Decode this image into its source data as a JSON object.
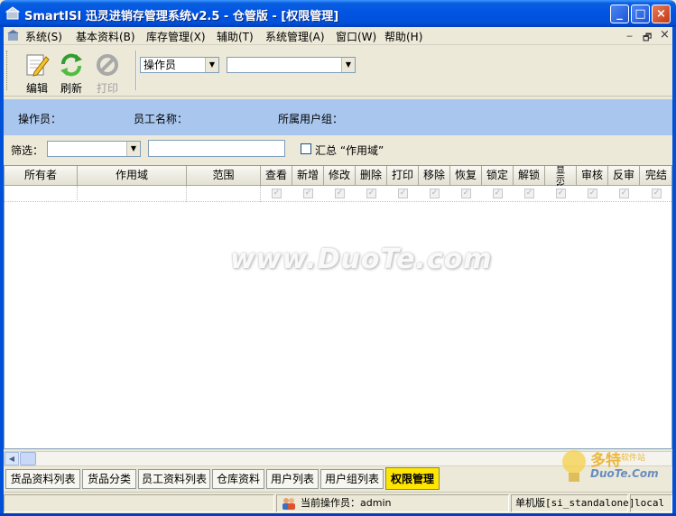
{
  "window": {
    "title": "SmartISI 迅灵进销存管理系统v2.5 - 仓管版 - [权限管理]",
    "minimize": "_",
    "maximize": "□",
    "close": "×"
  },
  "menu": {
    "items": [
      "系统(S)",
      "基本资料(B)",
      "库存管理(X)",
      "辅助(T)",
      "系统管理(A)",
      "窗口(W)",
      "帮助(H)"
    ],
    "mdi_min": "‒",
    "mdi_restore": "🗗",
    "mdi_close": "×"
  },
  "toolbar": {
    "edit_label": "编辑",
    "refresh_label": "刷新",
    "print_label": "打印",
    "type_select_value": "操作员",
    "target_select_value": ""
  },
  "info": {
    "operator_label": "操作员：",
    "employee_name_label": "员工名称：",
    "user_group_label": "所属用户组："
  },
  "filter": {
    "label": "筛选：",
    "select_value": "",
    "text_value": "",
    "summary_label": "汇总 “作用域”",
    "summary_checked": false
  },
  "grid": {
    "columns": [
      "所有者",
      "作用域",
      "范围",
      "查看",
      "新增",
      "修改",
      "删除",
      "打印",
      "移除",
      "恢复",
      "锁定",
      "解锁",
      "显示所有",
      "审核",
      "反审",
      "完结"
    ],
    "row_checks": [
      "✓",
      "✓",
      "✓",
      "✓",
      "✓",
      "✓",
      "✓",
      "✓",
      "✓",
      "✓",
      "✓",
      "✓",
      "✓"
    ]
  },
  "tabs": [
    "货品资料列表",
    "货品分类",
    "员工资料列表",
    "仓库资料",
    "用户列表",
    "用户组列表",
    "权限管理"
  ],
  "active_tab": "权限管理",
  "status": {
    "operator": "当前操作员：admin",
    "mode": "单机版[si_standalone]",
    "server": "local"
  },
  "watermark": {
    "text": "www.DuoTe.com",
    "logo_cn": "多特",
    "logo_small": "软件站",
    "logo_en": "DuoTe.Com"
  },
  "colors": {
    "title_bar": "#0054e3",
    "info_panel": "#a9c7ee",
    "active_tab": "#ffe600"
  }
}
